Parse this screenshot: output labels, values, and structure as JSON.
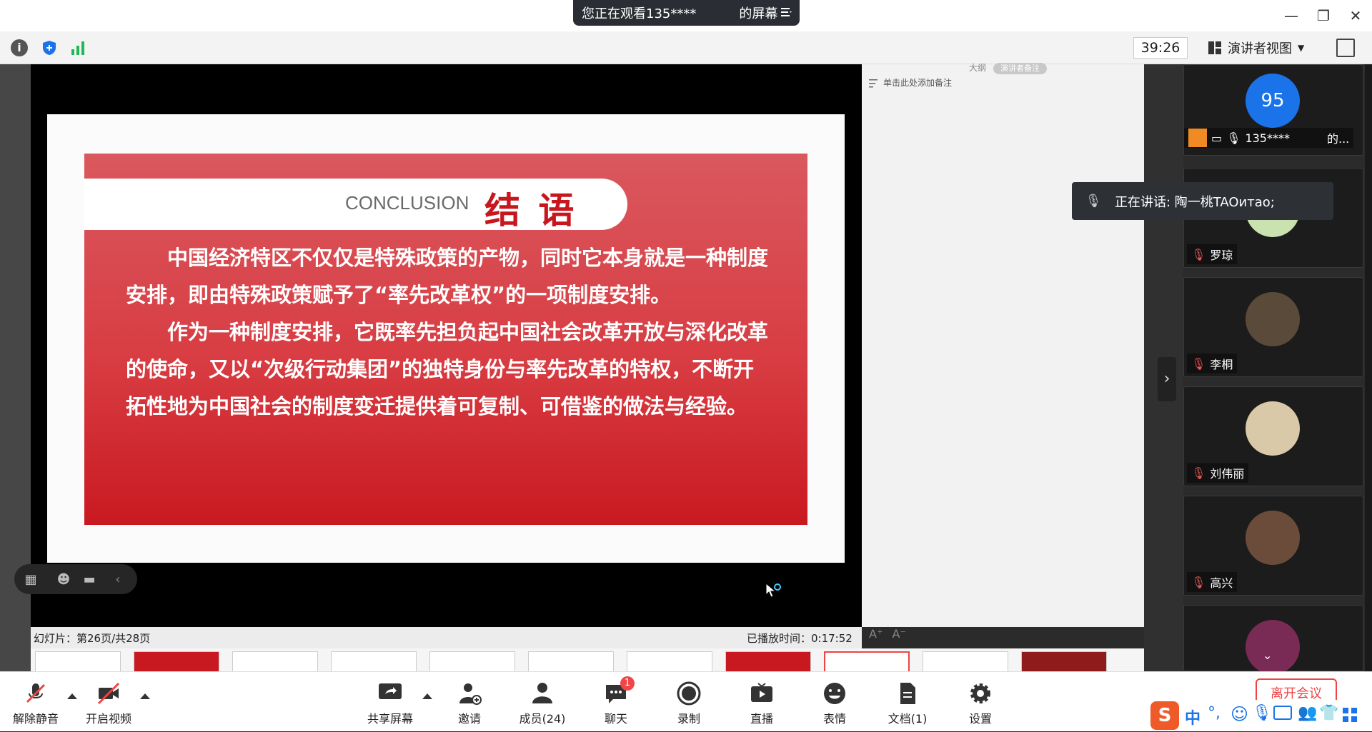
{
  "titlebar": {
    "viewing_text": "您正在观看135****",
    "viewing_suffix": "的屏幕"
  },
  "toolbar": {
    "timer": "39:26",
    "view_mode": "演讲者视图"
  },
  "slide": {
    "title_en": "CONCLUSION",
    "title_cn": "结 语",
    "para1": "中国经济特区不仅仅是特殊政策的产物，同时它本身就是一种制度安排，即由特殊政策赋予了“率先改革权”的一项制度安排。",
    "para2": "作为一种制度安排，它既率先担负起中国社会改革开放与深化改革的使命，又以“次级行动集团”的独特身份与率先改革的特权，不断开拓性地为中国社会的制度变迁提供着可复制、可借鉴的做法与经验。"
  },
  "notes": {
    "presenter_fragment": "大纲",
    "presenter_badge": "演讲者备注",
    "hint": "单击此处添加备注"
  },
  "status": {
    "slide_info": "幻灯片：第26页/共28页",
    "elapsed": "已播放时间：0:17:52",
    "font_increase": "A⁺",
    "font_decrease": "A⁻"
  },
  "speaking": {
    "text": "正在讲话: 陶一桃TAOитао;"
  },
  "participants": [
    {
      "name": "135****",
      "suffix": "的...",
      "score": "95"
    },
    {
      "name": "罗琼"
    },
    {
      "name": "李桐"
    },
    {
      "name": "刘伟丽"
    },
    {
      "name": "高兴"
    },
    {
      "name": ""
    }
  ],
  "bottombar": {
    "unmute": "解除静音",
    "start_video": "开启视频",
    "share_screen": "共享屏幕",
    "invite": "邀请",
    "members": "成员(24)",
    "chat": "聊天",
    "chat_badge": "1",
    "record": "录制",
    "live": "直播",
    "reactions": "表情",
    "docs": "文档(1)",
    "settings": "设置",
    "leave": "离开会议"
  },
  "colors": {
    "brand_red": "#c7161e",
    "accent_blue": "#1a73e8"
  }
}
